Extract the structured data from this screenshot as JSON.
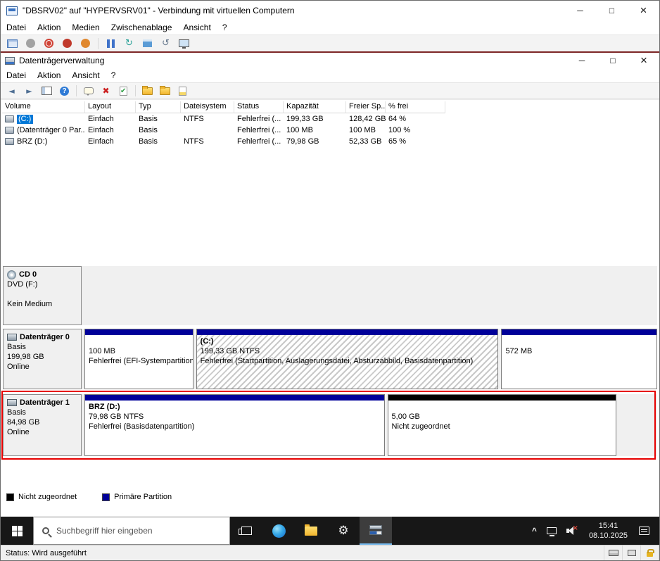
{
  "colors": {
    "accent": "#0078d7",
    "primary_partition": "#000099",
    "unallocated": "#000000",
    "annotation": "#e60000",
    "taskbar_active_underline": "#76b9ed"
  },
  "icons": {
    "minimize": "─",
    "maximize": "□",
    "restore": "□",
    "close": "×",
    "back": "◄",
    "forward": "►",
    "help": "?",
    "delete": "✖",
    "gear": "⚙",
    "chevron_up": "^",
    "reset": "↻",
    "revert": "↺",
    "mute": "×"
  },
  "vmconnect": {
    "title": "\"DBSRV02\" auf \"HYPERVSRV01\" - Verbindung mit virtuellen Computern",
    "menu": [
      "Datei",
      "Aktion",
      "Medien",
      "Zwischenablage",
      "Ansicht",
      "?"
    ],
    "status": "Status: Wird ausgeführt"
  },
  "disk_management": {
    "title": "Datenträgerverwaltung",
    "menu": [
      "Datei",
      "Aktion",
      "Ansicht",
      "?"
    ],
    "table": {
      "columns": [
        "Volume",
        "Layout",
        "Typ",
        "Dateisystem",
        "Status",
        "Kapazität",
        "Freier Sp...",
        "% frei"
      ],
      "rows": [
        {
          "volume": "(C:)",
          "layout": "Einfach",
          "typ": "Basis",
          "fs": "NTFS",
          "status": "Fehlerfrei (...",
          "kap": "199,33 GB",
          "frei": "128,42 GB",
          "pct": "64 %"
        },
        {
          "volume": "(Datenträger 0 Par...",
          "layout": "Einfach",
          "typ": "Basis",
          "fs": "",
          "status": "Fehlerfrei (...",
          "kap": "100 MB",
          "frei": "100 MB",
          "pct": "100 %"
        },
        {
          "volume": "BRZ (D:)",
          "layout": "Einfach",
          "typ": "Basis",
          "fs": "NTFS",
          "status": "Fehlerfrei (...",
          "kap": "79,98 GB",
          "frei": "52,33 GB",
          "pct": "65 %"
        }
      ]
    },
    "cd_row": {
      "name": "CD 0",
      "drive": "DVD (F:)",
      "media": "Kein Medium"
    },
    "disk0": {
      "name": "Datenträger 0",
      "type": "Basis",
      "size": "199,98 GB",
      "status": "Online",
      "partitions": [
        {
          "title": "",
          "cap": "100 MB",
          "status": "Fehlerfrei (EFI-Systempartition)"
        },
        {
          "title": "(C:)",
          "cap": "199,33 GB NTFS",
          "status": "Fehlerfrei (Startpartition, Auslagerungsdatei, Absturzabbild, Basisdatenpartition)"
        },
        {
          "title": "",
          "cap": "572 MB",
          "status": ""
        }
      ]
    },
    "disk1": {
      "name": "Datenträger 1",
      "type": "Basis",
      "size": "84,98 GB",
      "status": "Online",
      "partitions": [
        {
          "title": "BRZ (D:)",
          "cap": "79,98 GB NTFS",
          "status": "Fehlerfrei (Basisdatenpartition)"
        },
        {
          "title": "",
          "cap": "5,00 GB",
          "status": "Nicht zugeordnet"
        }
      ]
    },
    "legend": [
      {
        "label": "Nicht zugeordnet"
      },
      {
        "label": "Primäre Partition"
      }
    ]
  },
  "taskbar": {
    "search_placeholder": "Suchbegriff hier eingeben",
    "time": "15:41",
    "date": "08.10.2025"
  }
}
